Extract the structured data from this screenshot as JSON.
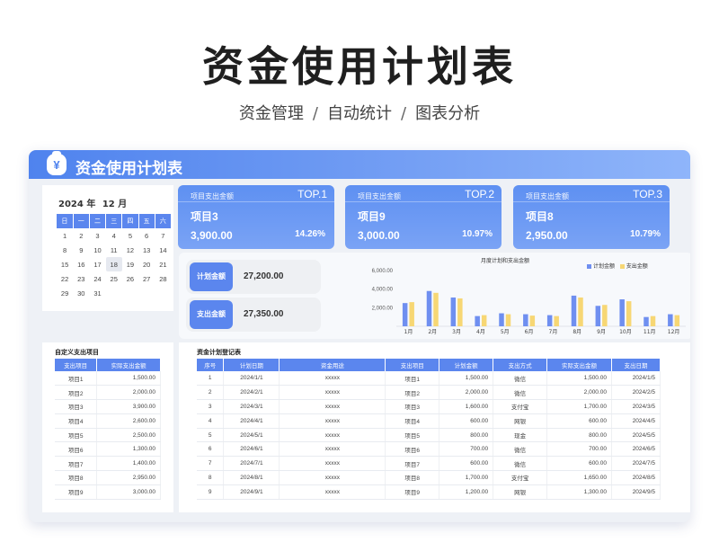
{
  "hero": {
    "title": "资金使用计划表",
    "sub1": "资金管理",
    "sub2": "自动统计",
    "sub3": "图表分析",
    "sep": "/"
  },
  "banner": {
    "title": "资金使用计划表",
    "icon": "money-bag-icon",
    "icon_glyph": "¥"
  },
  "calendar": {
    "year": "2024",
    "year_label": "年",
    "month": "12",
    "month_label": "月",
    "weekdays": [
      "日",
      "一",
      "二",
      "三",
      "四",
      "五",
      "六"
    ],
    "weeks": [
      [
        "1",
        "2",
        "3",
        "4",
        "5",
        "6",
        "7"
      ],
      [
        "8",
        "9",
        "10",
        "11",
        "12",
        "13",
        "14"
      ],
      [
        "15",
        "16",
        "17",
        "18",
        "19",
        "20",
        "21"
      ],
      [
        "22",
        "23",
        "24",
        "25",
        "26",
        "27",
        "28"
      ],
      [
        "29",
        "30",
        "31",
        "",
        "",
        "",
        ""
      ]
    ],
    "today": "18"
  },
  "top_cards": [
    {
      "caption": "项目支出金额",
      "rank": "TOP.1",
      "name": "项目3",
      "amount": "3,900.00",
      "percent": "14.26%"
    },
    {
      "caption": "项目支出金额",
      "rank": "TOP.2",
      "name": "项目9",
      "amount": "3,000.00",
      "percent": "10.97%"
    },
    {
      "caption": "项目支出金额",
      "rank": "TOP.3",
      "name": "项目8",
      "amount": "2,950.00",
      "percent": "10.79%"
    }
  ],
  "summary": {
    "plan_label": "计划金额",
    "plan_value": "27,200.00",
    "spend_label": "支出金额",
    "spend_value": "27,350.00"
  },
  "colors": {
    "accent": "#5b86ee",
    "plan_bar": "#6f8ff0",
    "spend_bar": "#f7d774"
  },
  "chart_data": {
    "type": "bar",
    "title": "月度计划和支出金额",
    "categories": [
      "1月",
      "2月",
      "3月",
      "4月",
      "5月",
      "6月",
      "7月",
      "8月",
      "9月",
      "10月",
      "11月",
      "12月"
    ],
    "series": [
      {
        "name": "计划金额",
        "values": [
          2500,
          3800,
          3100,
          1100,
          1400,
          1300,
          1200,
          3300,
          2200,
          2900,
          1000,
          1300
        ]
      },
      {
        "name": "支出金额",
        "values": [
          2600,
          3600,
          3000,
          1200,
          1300,
          1150,
          1100,
          3100,
          2300,
          2700,
          1100,
          1200
        ]
      }
    ],
    "yticks": [
      "2,000.00",
      "4,000.00",
      "6,000.00"
    ],
    "ylim": [
      0,
      6000
    ],
    "legend": "top-right",
    "grid": false
  },
  "custom_list": {
    "title": "自定义支出项目",
    "headers": [
      "支出项目",
      "实际支出金额"
    ],
    "rows": [
      [
        "项目1",
        "1,500.00"
      ],
      [
        "项目2",
        "2,000.00"
      ],
      [
        "项目3",
        "3,900.00"
      ],
      [
        "项目4",
        "2,600.00"
      ],
      [
        "项目5",
        "2,500.00"
      ],
      [
        "项目6",
        "1,300.00"
      ],
      [
        "项目7",
        "1,400.00"
      ],
      [
        "项目8",
        "2,950.00"
      ],
      [
        "项目9",
        "3,000.00"
      ]
    ]
  },
  "records": {
    "title": "资金计划登记表",
    "headers": [
      "序号",
      "计划日期",
      "资金用途",
      "支出项目",
      "计划金额",
      "支出方式",
      "实际支出金额",
      "支出日期"
    ],
    "rows": [
      [
        "1",
        "2024/1/1",
        "xxxxx",
        "项目1",
        "1,500.00",
        "微信",
        "1,500.00",
        "2024/1/5"
      ],
      [
        "2",
        "2024/2/1",
        "xxxxx",
        "项目2",
        "2,000.00",
        "微信",
        "2,000.00",
        "2024/2/5"
      ],
      [
        "3",
        "2024/3/1",
        "xxxxx",
        "项目3",
        "1,600.00",
        "支付宝",
        "1,700.00",
        "2024/3/5"
      ],
      [
        "4",
        "2024/4/1",
        "xxxxx",
        "项目4",
        "600.00",
        "网银",
        "600.00",
        "2024/4/5"
      ],
      [
        "5",
        "2024/5/1",
        "xxxxx",
        "项目5",
        "800.00",
        "现金",
        "800.00",
        "2024/5/5"
      ],
      [
        "6",
        "2024/6/1",
        "xxxxx",
        "项目6",
        "700.00",
        "微信",
        "700.00",
        "2024/6/5"
      ],
      [
        "7",
        "2024/7/1",
        "xxxxx",
        "项目7",
        "600.00",
        "微信",
        "600.00",
        "2024/7/5"
      ],
      [
        "8",
        "2024/8/1",
        "xxxxx",
        "项目8",
        "1,700.00",
        "支付宝",
        "1,650.00",
        "2024/8/5"
      ],
      [
        "9",
        "2024/9/1",
        "xxxxx",
        "项目9",
        "1,200.00",
        "网银",
        "1,300.00",
        "2024/9/5"
      ]
    ]
  }
}
